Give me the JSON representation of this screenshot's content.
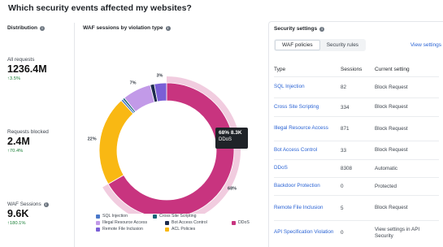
{
  "page": {
    "title": "Which security events affected my websites?"
  },
  "distribution": {
    "heading": "Distribution",
    "metrics": [
      {
        "label": "All requests",
        "value": "1236.4M",
        "delta": "↑3.5%"
      },
      {
        "label": "Requests blocked",
        "value": "2.4M",
        "delta": "↑70.4%"
      },
      {
        "label": "WAF Sessions",
        "value": "9.6K",
        "delta": "↑180.1%"
      }
    ]
  },
  "waf_chart": {
    "heading": "WAF sessions by violation type",
    "tooltip": {
      "value": "68% 8.3K",
      "name": "DDoS"
    },
    "legend": [
      "SQL Injection",
      "Cross Site Scripting",
      "Illegal Resource Access",
      "Bot Access Control",
      "DDoS",
      "Remote File Inclusion",
      "ACL Policies"
    ]
  },
  "chart_data": {
    "type": "pie",
    "title": "WAF sessions by violation type",
    "donut": true,
    "slices": [
      {
        "name": "DDoS",
        "percent": 68,
        "label": "68%",
        "color": "#c8347f"
      },
      {
        "name": "ACL Policies",
        "percent": 22,
        "label": "22%",
        "color": "#f9b813"
      },
      {
        "name": "SQL Injection",
        "percent": 0.5,
        "label": "",
        "color": "#4a78c9"
      },
      {
        "name": "Cross Site Scripting",
        "percent": 0.5,
        "label": "",
        "color": "#1a6478"
      },
      {
        "name": "Illegal Resource Access",
        "percent": 7,
        "label": "7%",
        "color": "#c29ae8"
      },
      {
        "name": "Bot Access Control",
        "percent": 1,
        "label": "",
        "color": "#1d2b4e"
      },
      {
        "name": "Remote File Inclusion",
        "percent": 3,
        "label": "3%",
        "color": "#7a5fd6"
      }
    ]
  },
  "settings": {
    "heading": "Security settings",
    "tabs": [
      "WAF policies",
      "Security rules"
    ],
    "view_link": "View settings",
    "columns": [
      "Type",
      "Sessions",
      "Current setting"
    ],
    "rows": [
      {
        "type": "SQL Injection",
        "sessions": "82",
        "setting": "Block Request"
      },
      {
        "type": "Cross Site Scripting",
        "sessions": "334",
        "setting": "Block Request"
      },
      {
        "type": "Illegal Resource Access",
        "sessions": "871",
        "setting": "Block Request"
      },
      {
        "type": "Bot Access Control",
        "sessions": "33",
        "setting": "Block Request"
      },
      {
        "type": "DDoS",
        "sessions": "8308",
        "setting": "Automatic"
      },
      {
        "type": "Backdoor Protection",
        "sessions": "0",
        "setting": "Protected"
      },
      {
        "type": "Remote File Inclusion",
        "sessions": "5",
        "setting": "Block Request"
      },
      {
        "type": "API Specification Violation",
        "sessions": "0",
        "setting": "View settings in API Security"
      }
    ]
  },
  "colors": {
    "accent_link": "#2a63d4",
    "positive": "#1a7f37",
    "ddos": "#c8347f",
    "acl": "#f9b813"
  }
}
